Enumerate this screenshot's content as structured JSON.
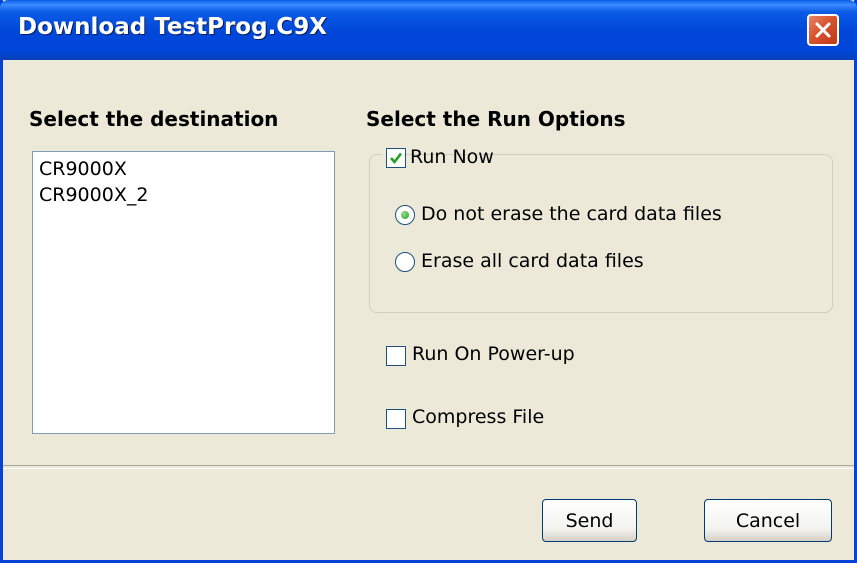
{
  "window": {
    "title": "Download TestProg.C9X"
  },
  "destination": {
    "heading": "Select the destination",
    "items": [
      "CR9000X",
      "CR9000X_2"
    ]
  },
  "run_options": {
    "heading": "Select the Run Options",
    "run_now": {
      "label": "Run Now",
      "checked": true
    },
    "radios": [
      {
        "label": "Do not erase the card data files",
        "selected": true
      },
      {
        "label": "Erase all card data files",
        "selected": false
      }
    ],
    "run_on_powerup": {
      "label": "Run On Power-up",
      "checked": false
    },
    "compress_file": {
      "label": "Compress File",
      "checked": false
    }
  },
  "buttons": {
    "send": "Send",
    "cancel": "Cancel"
  },
  "icons": {
    "close": "close-icon",
    "check": "checkmark-icon"
  },
  "colors": {
    "title_bar": "#0046d8",
    "close_button": "#d8532e",
    "check_mark": "#21a121",
    "face": "#ece9d8"
  }
}
